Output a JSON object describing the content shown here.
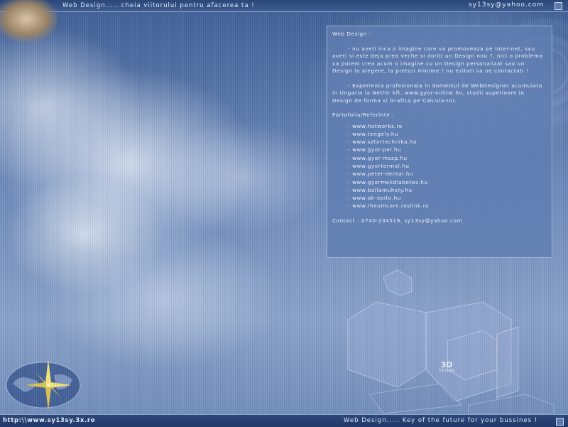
{
  "header": {
    "tagline": "Web Design..... cheia viitorului pentru afacerea ta !",
    "email": "sy13sy@yahoo.com"
  },
  "panel": {
    "heading": "Web Design :",
    "paragraph1": "- nu aveti inca o imagine care va promoveaza pe Inter-net, sau aveti si este deja prea veche si doriti un Design nou ?, nici o problema va putem crea acum o imagine cu un Design personalizat sau un Design la alegere, la preturi minime ! nu ezitati sa ne contactati !",
    "paragraph2": "- Experienta profesionala in domeniul de WebDesigner acumulata in Ungaria la Nethir kft. www.gyor-online.hu, studii superioare in Design de forma si Grafica pe Calcula-tor.",
    "portfolio_title": "Portofoliu/Referinte :",
    "links": [
      "- www.hotworks.ro",
      "- www.tengely.hu",
      "- www.sztartechnika.hu",
      "- www.gyor-per.hu",
      "- www.gyor-mszp.hu",
      "- www.gyortermal.hu",
      "- www.peter-dental.hu",
      "- www.gyermekdiabetes.hu",
      "- www.bollamuhely.hu",
      "- www.ak-epito.hu",
      "- www.rheumcare.roslink.ro"
    ],
    "contact": "Contact : 0740-234519, sy13sy@yahoo.com"
  },
  "footer": {
    "url": "http:\\\\www.sy13sy.3x.ro",
    "tagline": "Web Design..... Key of the future for your bussines !"
  },
  "logo": {
    "line1": "3D",
    "line2": "DESIGN"
  },
  "colors": {
    "bar": "#2b4778",
    "panel": "#5f7db2",
    "text": "#eef2fa"
  }
}
